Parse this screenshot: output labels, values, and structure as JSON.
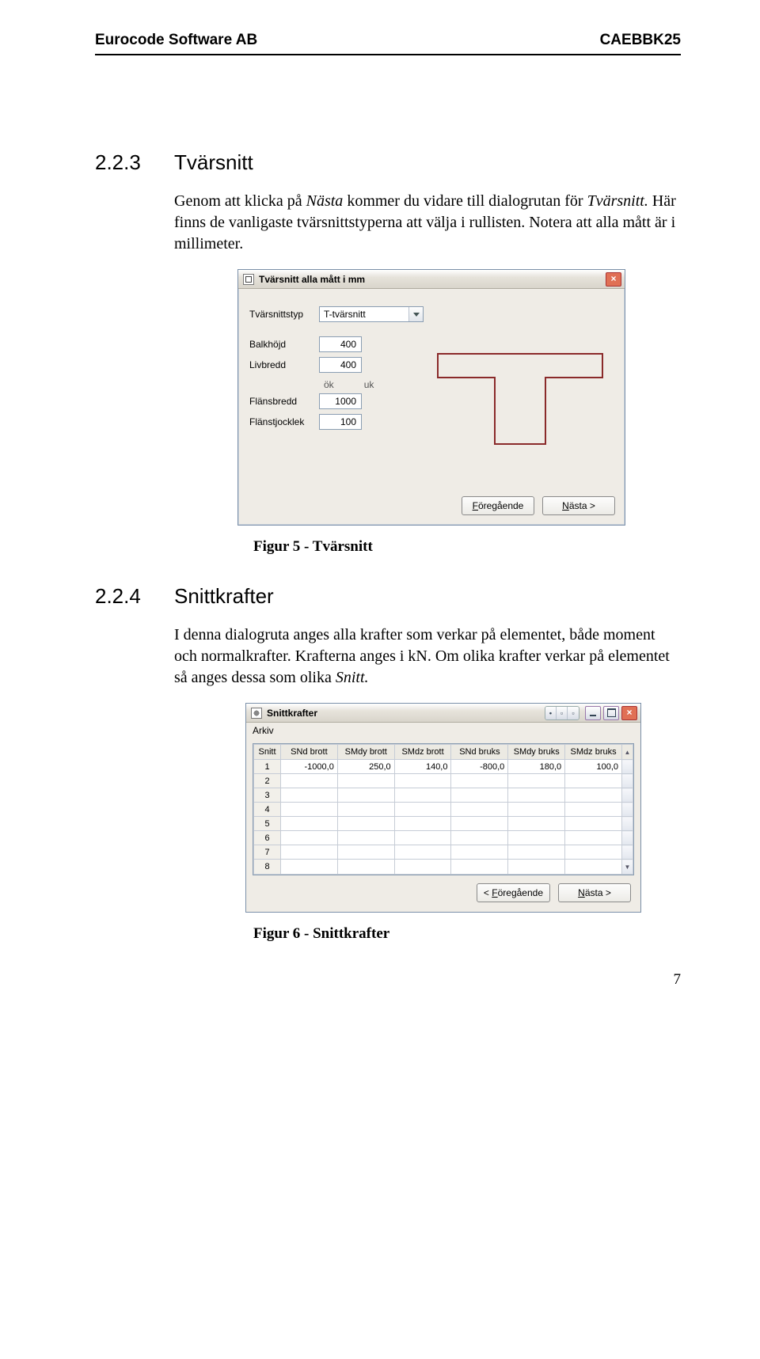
{
  "header": {
    "left": "Eurocode Software AB",
    "right": "CAEBBK25"
  },
  "sec1": {
    "num": "2.2.3",
    "title": "Tvärsnitt",
    "p_a": "Genom att klicka på ",
    "p_b": "Nästa",
    "p_c": " kommer du vidare till dialogrutan för ",
    "p_d": "Tvärsnitt.",
    "p_e": " Här finns de vanligaste tvärsnittstyperna att välja i rullisten. Notera att alla mått är i millimeter."
  },
  "dialog1": {
    "title": "Tvärsnitt alla mått i mm",
    "fields": {
      "tv_label": "Tvärsnittstyp",
      "tv_value": "T-tvärsnitt",
      "balk_label": "Balkhöjd",
      "balk_value": "400",
      "liv_label": "Livbredd",
      "liv_value": "400",
      "ok": "ök",
      "uk": "uk",
      "flb_label": "Flänsbredd",
      "flb_value": "1000",
      "flt_label": "Flänstjocklek",
      "flt_value": "100"
    },
    "prev": "< Föregående",
    "next": "Nästa >"
  },
  "fig1": "Figur 5 - Tvärsnitt",
  "sec2": {
    "num": "2.2.4",
    "title": "Snittkrafter",
    "p_a": "I denna dialogruta anges alla krafter som verkar på elementet, både moment och normalkrafter. Krafterna anges i kN. Om olika krafter verkar på elementet så anges dessa som olika ",
    "p_b": "Snitt."
  },
  "dialog2": {
    "title": "Snittkrafter",
    "menu": "Arkiv",
    "cols": [
      "Snitt",
      "SNd brott",
      "SMdy brott",
      "SMdz brott",
      "SNd bruks",
      "SMdy bruks",
      "SMdz bruks"
    ],
    "rows": [
      {
        "n": "1",
        "v": [
          "-1000,0",
          "250,0",
          "140,0",
          "-800,0",
          "180,0",
          "100,0"
        ]
      },
      {
        "n": "2",
        "v": [
          "",
          "",
          "",
          "",
          "",
          ""
        ]
      },
      {
        "n": "3",
        "v": [
          "",
          "",
          "",
          "",
          "",
          ""
        ]
      },
      {
        "n": "4",
        "v": [
          "",
          "",
          "",
          "",
          "",
          ""
        ]
      },
      {
        "n": "5",
        "v": [
          "",
          "",
          "",
          "",
          "",
          ""
        ]
      },
      {
        "n": "6",
        "v": [
          "",
          "",
          "",
          "",
          "",
          ""
        ]
      },
      {
        "n": "7",
        "v": [
          "",
          "",
          "",
          "",
          "",
          ""
        ]
      },
      {
        "n": "8",
        "v": [
          "",
          "",
          "",
          "",
          "",
          ""
        ]
      }
    ],
    "prev": "< Föregående",
    "next": "Nästa >"
  },
  "fig2": "Figur 6 - Snittkrafter",
  "pagenum": "7"
}
